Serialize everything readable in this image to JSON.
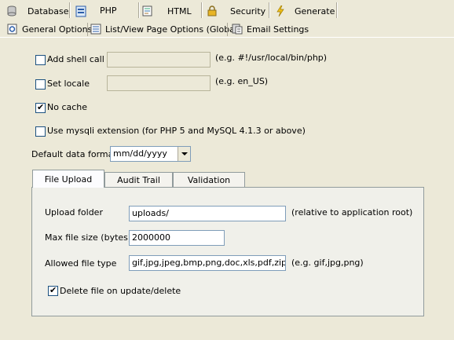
{
  "top_tabs": [
    {
      "label": "Database",
      "icon": "database-icon"
    },
    {
      "label": "PHP",
      "icon": "php-page-icon",
      "active": true
    },
    {
      "label": "HTML",
      "icon": "html-page-icon"
    },
    {
      "label": "Security",
      "icon": "lock-icon"
    },
    {
      "label": "Generate",
      "icon": "lightning-icon"
    }
  ],
  "sub_tabs": [
    {
      "label": "General Options",
      "icon": "general-options-icon",
      "active": true
    },
    {
      "label": "List/View Page Options (Global)",
      "icon": "list-view-icon"
    },
    {
      "label": "Email Settings",
      "icon": "email-settings-icon"
    }
  ],
  "options": {
    "shell_call": {
      "label": "Add shell call",
      "checked": false,
      "value": "",
      "hint": "(e.g. #!/usr/local/bin/php)"
    },
    "set_locale": {
      "label": "Set locale",
      "checked": false,
      "value": "",
      "hint": "(e.g. en_US)"
    },
    "no_cache": {
      "label": "No cache",
      "checked": true
    },
    "mysqli": {
      "label": "Use mysqli extension (for PHP 5 and MySQL 4.1.3 or above)",
      "checked": false
    },
    "date_format": {
      "label": "Default data format",
      "value": "mm/dd/yyyy"
    }
  },
  "inner_tabs": [
    {
      "label": "File Upload",
      "active": true
    },
    {
      "label": "Audit Trail"
    },
    {
      "label": "Validation"
    }
  ],
  "file_upload": {
    "upload_folder": {
      "label": "Upload folder",
      "value": "uploads/",
      "hint": "(relative to application root)"
    },
    "max_file_size": {
      "label": "Max file size (bytes)",
      "value": "2000000"
    },
    "allowed_types": {
      "label": "Allowed file type",
      "value": "gif,jpg,jpeg,bmp,png,doc,xls,pdf,zip",
      "hint": "(e.g. gif,jpg,png)"
    },
    "delete_on_update": {
      "label": "Delete file on update/delete",
      "checked": true
    }
  },
  "colors": {
    "background": "#ece9d8",
    "input_border": "#7f9db9",
    "tab_border": "#919b9c"
  }
}
